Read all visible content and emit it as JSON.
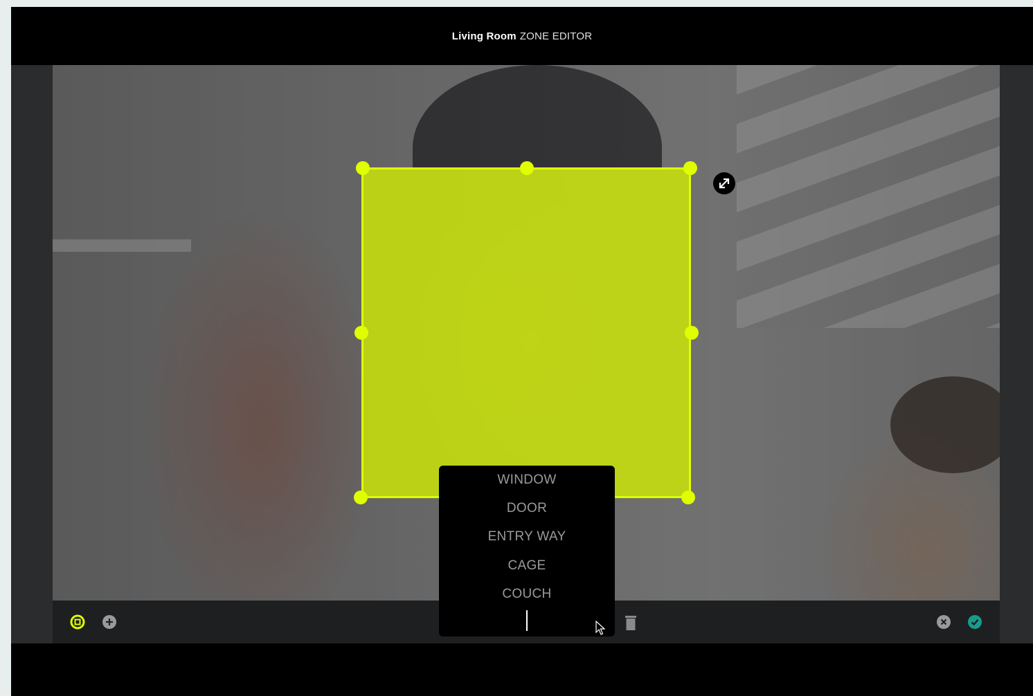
{
  "header": {
    "room_name": "Living Room",
    "title_suffix": "ZONE EDITOR"
  },
  "zone": {
    "fill_color": "#dfff00"
  },
  "zone_label_menu": {
    "options": [
      "WINDOW",
      "DOOR",
      "ENTRY WAY",
      "CAGE",
      "COUCH"
    ],
    "input_value": ""
  },
  "toolbar": {
    "left_icons": [
      "zone-select-icon",
      "add-zone-icon"
    ],
    "center_icons": [
      "trash-icon"
    ],
    "right_icons": [
      "cancel-icon",
      "confirm-icon"
    ],
    "accent_color": "#dfff00",
    "confirm_color": "#1a9a8a"
  }
}
